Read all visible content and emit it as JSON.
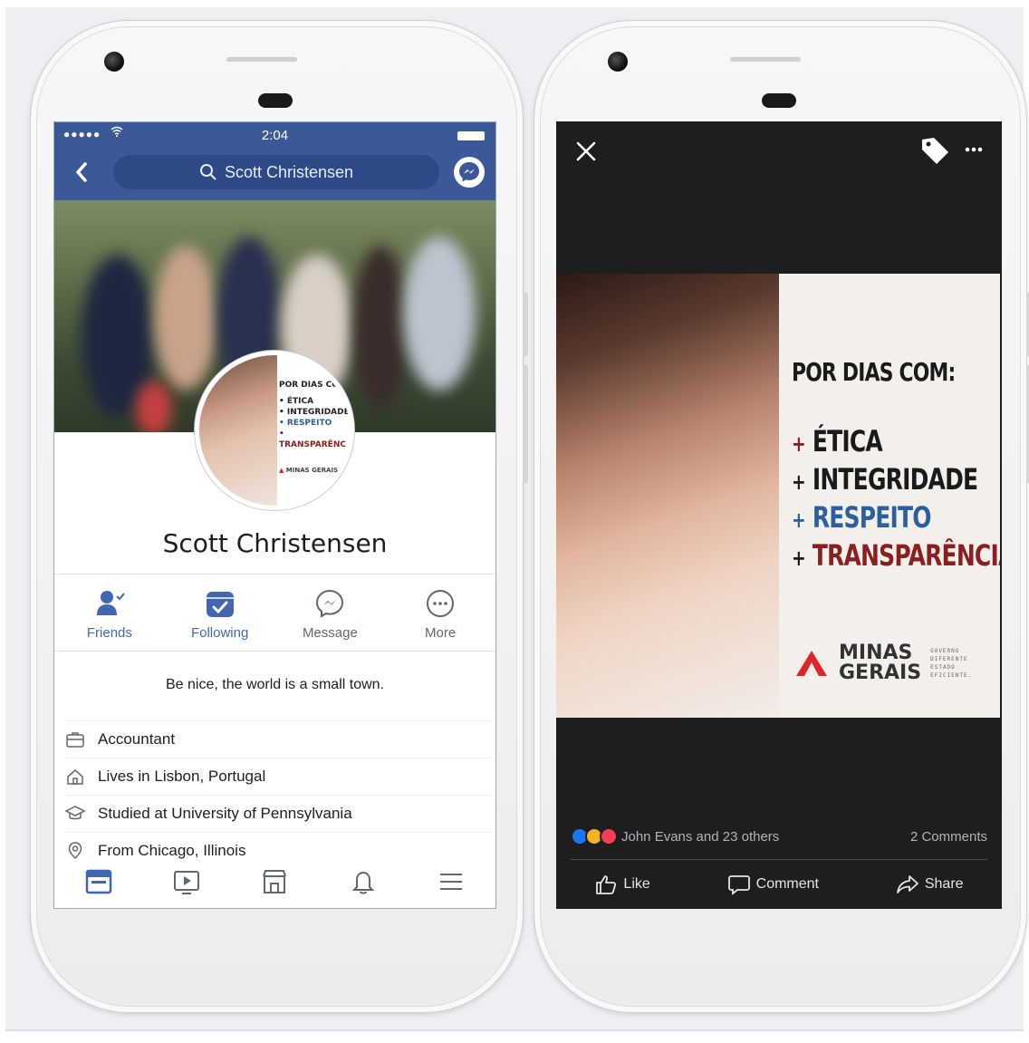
{
  "profile_screen": {
    "status": {
      "time": "2:04",
      "signal": "●●●●●"
    },
    "search": {
      "query": "Scott Christensen"
    },
    "profile": {
      "name": "Scott Christensen",
      "bio": "Be nice, the world is a small town."
    },
    "avatar_post": {
      "heading": "POR DIAS CO",
      "items": [
        "ÉTICA",
        "INTEGRIDADE",
        "RESPEITO",
        "TRANSPARÊNC"
      ],
      "brand": "MINAS GERAIS"
    },
    "actions": [
      {
        "label": "Friends",
        "icon": "friends-icon",
        "active": true
      },
      {
        "label": "Following",
        "icon": "following-icon",
        "active": true
      },
      {
        "label": "Message",
        "icon": "messenger-icon",
        "active": false
      },
      {
        "label": "More",
        "icon": "more-icon",
        "active": false
      }
    ],
    "info": [
      {
        "text": "Accountant",
        "icon": "briefcase-icon"
      },
      {
        "text": "Lives in Lisbon, Portugal",
        "icon": "home-icon"
      },
      {
        "text": "Studied at University of Pennsylvania",
        "icon": "graduation-cap-icon"
      },
      {
        "text": "From Chicago, Illinois",
        "icon": "location-pin-icon"
      }
    ],
    "tabs": [
      "news-feed-icon",
      "watch-icon",
      "marketplace-icon",
      "notifications-icon",
      "menu-icon"
    ],
    "colors": {
      "brand_blue": "#3b5998",
      "search_bg": "#2d4a86",
      "active_action": "#4267b2"
    }
  },
  "photo_screen": {
    "post": {
      "heading": "POR DIAS COM:",
      "items": [
        "ÉTICA",
        "INTEGRIDADE",
        "RESPEITO",
        "TRANSPARÊNCIA"
      ],
      "plus_sign": "+",
      "brand_name_line1": "MINAS",
      "brand_name_line2": "GERAIS",
      "brand_sub": [
        "GOVERNO",
        "DIFERENTE",
        "ESTADO",
        "EFICIENTE."
      ]
    },
    "reactions": {
      "text": "John Evans and 23 others",
      "comments": "2 Comments",
      "icons": [
        "like-reaction-icon",
        "wow-reaction-icon",
        "love-reaction-icon"
      ]
    },
    "actions": [
      {
        "label": "Like",
        "icon": "thumbs-up-icon"
      },
      {
        "label": "Comment",
        "icon": "comment-icon"
      },
      {
        "label": "Share",
        "icon": "share-icon"
      }
    ],
    "colors": {
      "background": "#1e1e1e",
      "heading_blue": "#2b5f9e",
      "accent_red": "#8b1e1e"
    }
  }
}
